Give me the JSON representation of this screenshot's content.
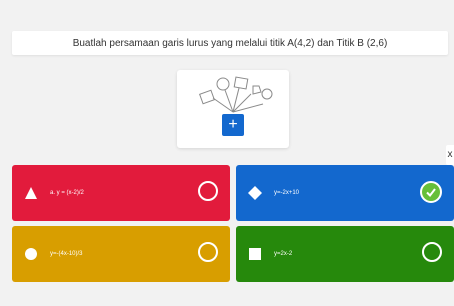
{
  "question": {
    "text": "Buatlah persamaan garis lurus yang melalui titik A(4,2) dan Titik B (2,6)"
  },
  "media": {
    "add_label": "+"
  },
  "side_arrow": "x",
  "answers": [
    {
      "shape": "triangle-icon",
      "text": "a. y = (x-2)/2",
      "color": "#e21b3c",
      "correct": false
    },
    {
      "shape": "diamond-icon",
      "text": "y=-2x+10",
      "color": "#1368ce",
      "correct": true
    },
    {
      "shape": "circle-icon",
      "text": "y=-(4x-10)/3",
      "color": "#d89e00",
      "correct": false
    },
    {
      "shape": "square-icon",
      "text": "y=2x-2",
      "color": "#26890c",
      "correct": false
    }
  ]
}
